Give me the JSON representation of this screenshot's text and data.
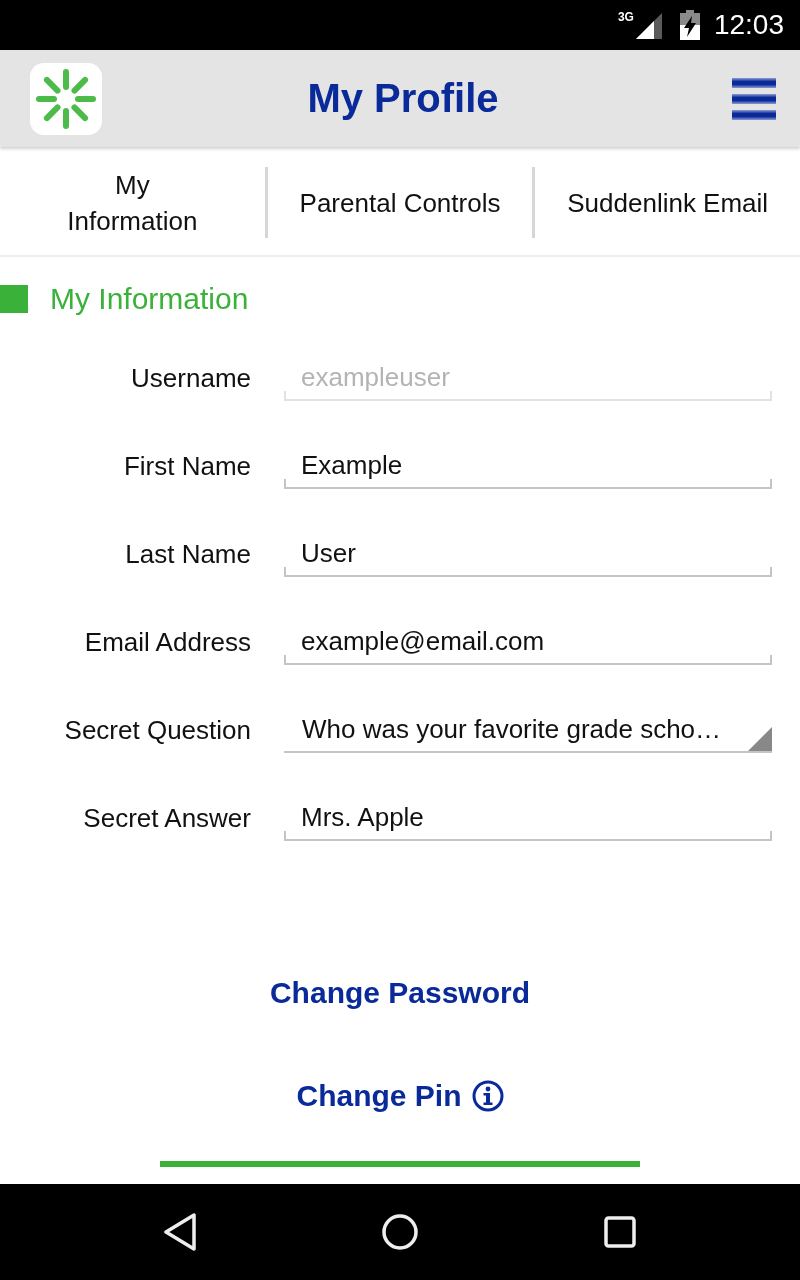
{
  "status_bar": {
    "network": "3G",
    "time": "12:03"
  },
  "app_bar": {
    "title": "My Profile"
  },
  "tabs": [
    {
      "label": "My\nInformation"
    },
    {
      "label": "Parental Controls"
    },
    {
      "label": "Suddenlink Email"
    }
  ],
  "section": {
    "title": "My Information"
  },
  "fields": [
    {
      "kind": "text",
      "label": "Username",
      "value": "exampleuser",
      "disabled": true
    },
    {
      "kind": "text",
      "label": "First Name",
      "value": "Example",
      "disabled": false
    },
    {
      "kind": "text",
      "label": "Last Name",
      "value": "User",
      "disabled": false
    },
    {
      "kind": "text",
      "label": "Email Address",
      "value": "example@email.com",
      "disabled": false
    },
    {
      "kind": "dropdown",
      "label": "Secret Question",
      "value": "Who was your favorite grade scho…"
    },
    {
      "kind": "text",
      "label": "Secret Answer",
      "value": "Mrs. Apple",
      "disabled": false
    }
  ],
  "actions": [
    {
      "label": "Change Password",
      "info": false
    },
    {
      "label": "Change Pin",
      "info": true
    }
  ]
}
